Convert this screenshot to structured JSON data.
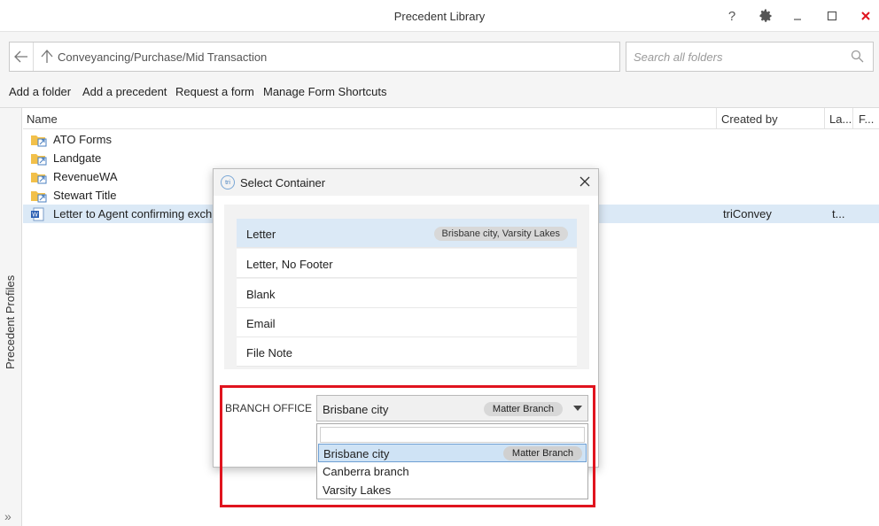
{
  "window": {
    "title": "Precedent Library"
  },
  "path": {
    "current": "Conveyancing/Purchase/Mid Transaction"
  },
  "search": {
    "placeholder": "Search all folders"
  },
  "toolbar": {
    "add_folder": "Add a folder",
    "add_precedent": "Add a precedent",
    "request_form": "Request a form",
    "manage_shortcuts": "Manage Form Shortcuts"
  },
  "side": {
    "label": "Precedent Profiles"
  },
  "columns": {
    "name": "Name",
    "created_by": "Created by",
    "language": "La...",
    "format": "F..."
  },
  "rows": [
    {
      "name": "ATO Forms",
      "type": "folder"
    },
    {
      "name": "Landgate",
      "type": "folder"
    },
    {
      "name": "RevenueWA",
      "type": "folder"
    },
    {
      "name": "Stewart Title",
      "type": "folder"
    },
    {
      "name": "Letter to Agent confirming exch",
      "type": "word-doc",
      "created_by": "triConvey",
      "lang": "t..."
    }
  ],
  "dialog": {
    "title": "Select Container",
    "logo_text": "tri",
    "containers": [
      {
        "label": "Letter",
        "badge": "Brisbane city, Varsity Lakes",
        "selected": true
      },
      {
        "label": "Letter, No Footer"
      },
      {
        "label": "Blank"
      },
      {
        "label": "Email"
      },
      {
        "label": "File Note"
      }
    ],
    "branch_label": "BRANCH OFFICE",
    "branch_value": "Brisbane city",
    "branch_badge": "Matter Branch",
    "branch_options": [
      {
        "label": "Brisbane city",
        "badge": "Matter Branch",
        "selected": true
      },
      {
        "label": "Canberra branch"
      },
      {
        "label": "Varsity Lakes"
      }
    ]
  },
  "colors": {
    "highlight": "#e0141e",
    "selection": "#dbe9f6",
    "close_red": "#e0141e"
  }
}
